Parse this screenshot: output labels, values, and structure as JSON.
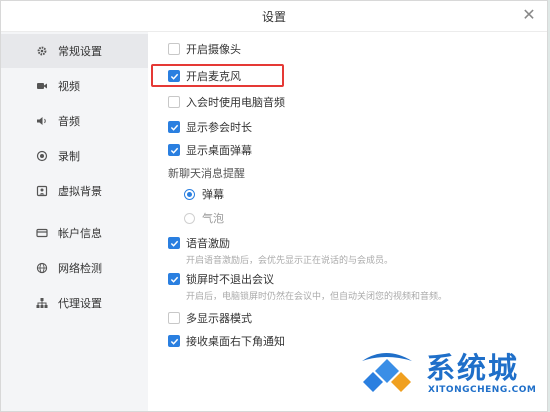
{
  "window": {
    "title": "设置"
  },
  "sidebar": {
    "items": [
      {
        "label": "常规设置",
        "icon": "gear-icon"
      },
      {
        "label": "视频",
        "icon": "camera-icon"
      },
      {
        "label": "音频",
        "icon": "speaker-icon"
      },
      {
        "label": "录制",
        "icon": "record-icon"
      },
      {
        "label": "虚拟背景",
        "icon": "portrait-icon"
      },
      {
        "label": "帐户信息",
        "icon": "card-icon"
      },
      {
        "label": "网络检测",
        "icon": "globe-icon"
      },
      {
        "label": "代理设置",
        "icon": "network-icon"
      }
    ],
    "active": "常规设置"
  },
  "settings": {
    "camera": {
      "label": "开启摄像头",
      "checked": false
    },
    "mic": {
      "label": "开启麦克风",
      "checked": true
    },
    "pc_audio": {
      "label": "入会时使用电脑音频",
      "checked": false
    },
    "show_duration": {
      "label": "显示参会时长",
      "checked": true
    },
    "show_danmu": {
      "label": "显示桌面弹幕",
      "checked": true
    },
    "new_msg_title": "新聊天消息提醒",
    "msg_danmu": {
      "label": "弹幕",
      "selected": true
    },
    "msg_bubble": {
      "label": "气泡",
      "selected": false
    },
    "voice_excite": {
      "label": "语音激励",
      "checked": true
    },
    "voice_excite_desc": "开启语音激励后，会优先显示正在说话的与会成员。",
    "lock_screen": {
      "label": "锁屏时不退出会议",
      "checked": true
    },
    "lock_screen_desc": "开启后，电脑锁屏时仍然在会议中，但自动关闭您的视频和音频。",
    "multi_display": {
      "label": "多显示器模式",
      "checked": false
    },
    "notify": {
      "label": "接收桌面右下角通知",
      "checked": true
    }
  },
  "watermark": {
    "text": "系统城",
    "sub": "XITONGCHENG.COM"
  },
  "colors": {
    "accent": "#2a7fe0",
    "highlight": "#e53935",
    "sidebar_bg": "#f4f5f7"
  }
}
